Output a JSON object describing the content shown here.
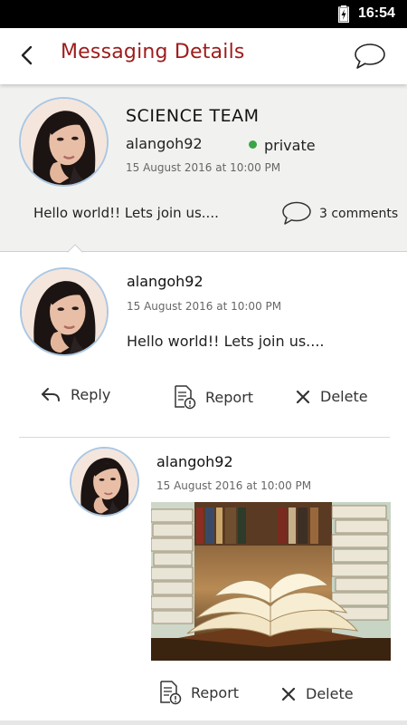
{
  "status_bar": {
    "time": "16:54",
    "battery_icon": "battery-charging-icon"
  },
  "app_bar": {
    "title": "Messaging Details",
    "back_icon": "back-arrow-icon",
    "chat_icon": "chat-bubble-icon",
    "title_color": "#9e1b1b"
  },
  "post": {
    "group_name": "SCIENCE TEAM",
    "username": "alangoh92",
    "privacy": "private",
    "privacy_color": "#3aa544",
    "timestamp": "15 August 2016 at 10:00 PM",
    "message": "Hello world!! Lets join us....",
    "comments": "3 comments"
  },
  "comment": {
    "username": "alangoh92",
    "timestamp": "15 August 2016 at 10:00 PM",
    "message": "Hello world!! Lets join us....",
    "actions": {
      "reply": "Reply",
      "report": "Report",
      "delete": "Delete"
    }
  },
  "reply": {
    "username": "alangoh92",
    "timestamp": "15 August 2016 at 10:00 PM",
    "image": "open-books-photo",
    "actions": {
      "report": "Report",
      "delete": "Delete"
    }
  }
}
